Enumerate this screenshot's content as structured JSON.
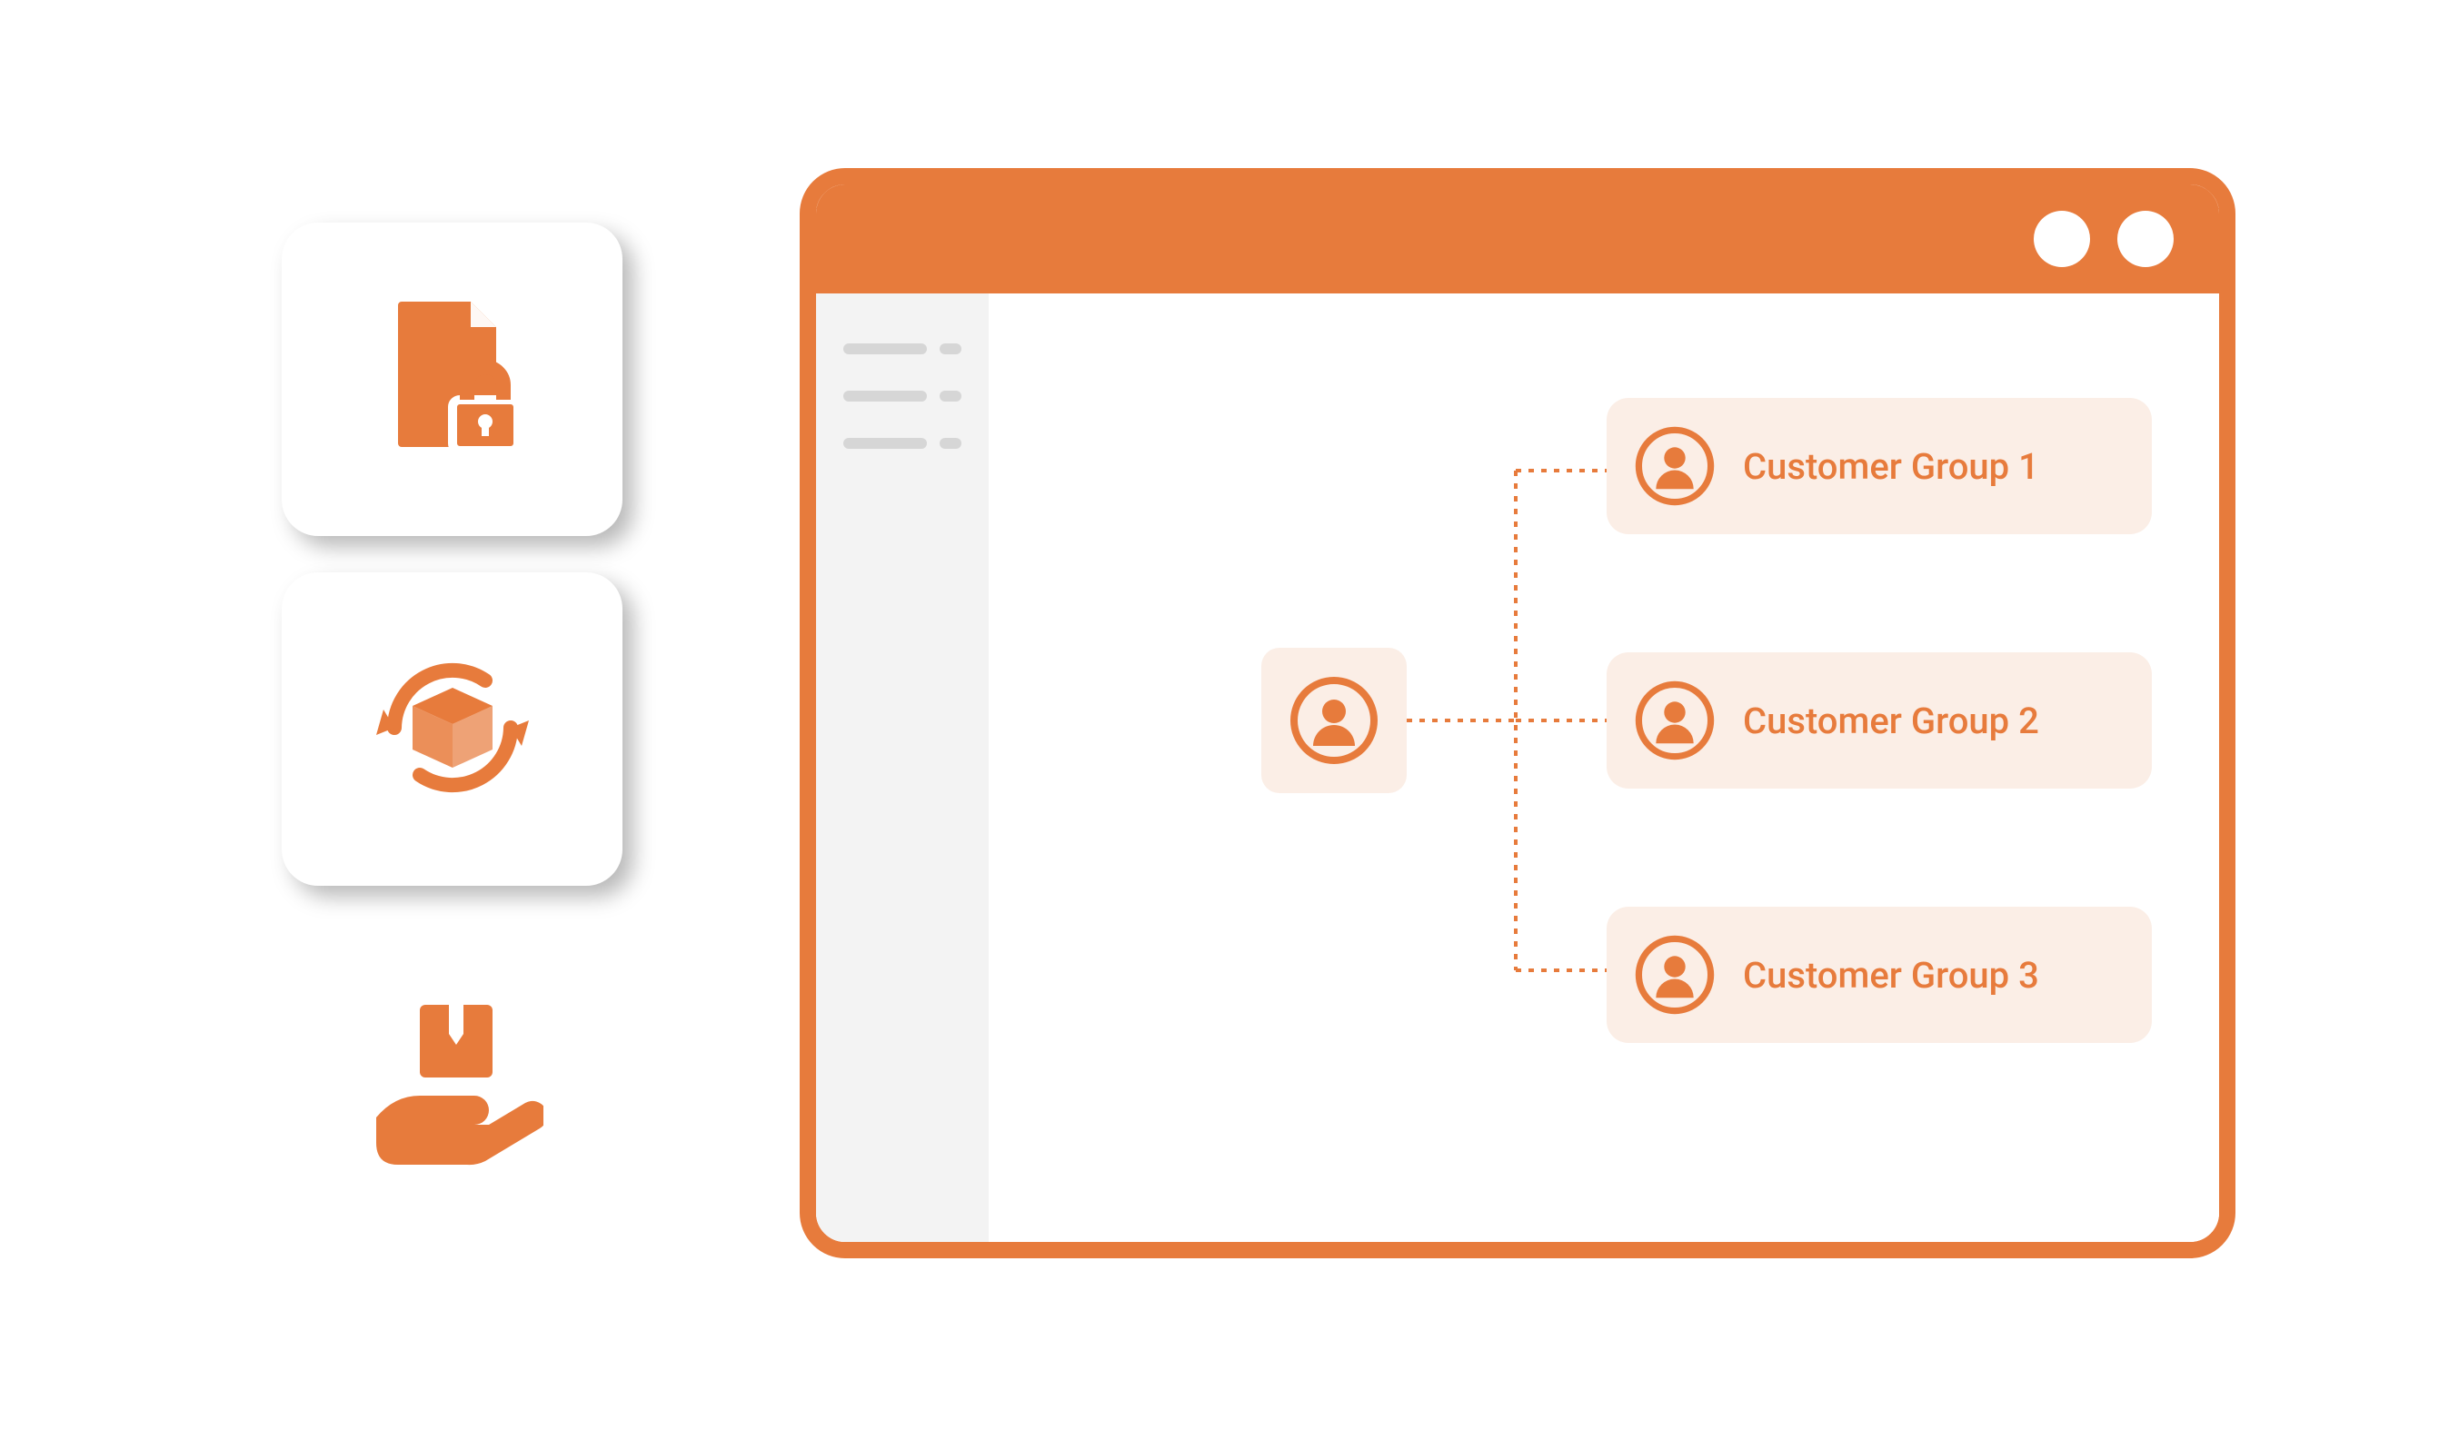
{
  "features": {
    "card1_icon": "file-lock-icon",
    "card2_icon": "box-cycle-icon",
    "card3_icon": "hand-box-icon"
  },
  "colors": {
    "accent": "#e77b3c",
    "node_bg": "#fbeee6",
    "sidebar_bg": "#f3f3f3",
    "placeholder": "#d6d6d6"
  },
  "browser": {
    "window_dots": 2,
    "sidebar_rows": 3
  },
  "groups": {
    "root_icon": "user-icon",
    "items": [
      {
        "label": "Customer Group 1"
      },
      {
        "label": "Customer Group 2"
      },
      {
        "label": "Customer Group 3"
      }
    ]
  }
}
